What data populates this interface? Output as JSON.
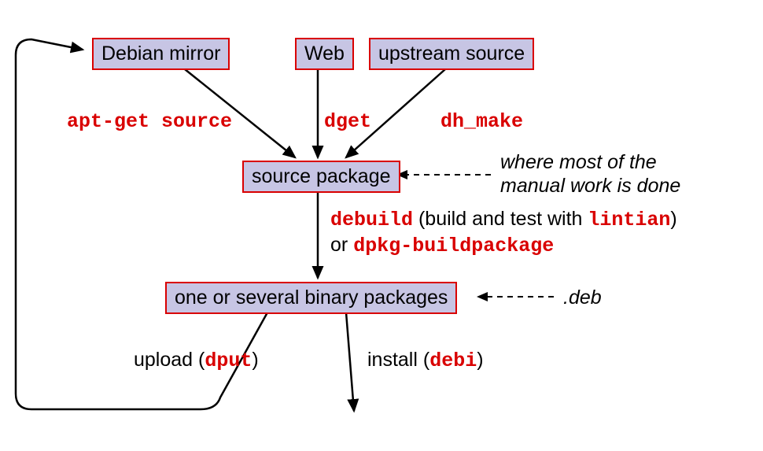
{
  "nodes": {
    "debian_mirror": "Debian mirror",
    "web": "Web",
    "upstream_source": "upstream source",
    "source_package": "source package",
    "binary_packages": "one or several binary packages"
  },
  "edges": {
    "apt_get_source": "apt-get source",
    "dget": "dget",
    "dh_make": "dh_make",
    "debuild_pre": "debuild",
    "debuild_mid": " (build and test with ",
    "lintian": "lintian",
    "debuild_post": ")",
    "or_text": "or ",
    "dpkg_buildpackage": "dpkg-buildpackage",
    "upload_pre": "upload (",
    "dput": "dput",
    "upload_post": ")",
    "install_pre": "install (",
    "debi": "debi",
    "install_post": ")"
  },
  "annotations": {
    "manual_work_line1": "where most of the",
    "manual_work_line2": "manual work is done",
    "deb_ext": ".deb"
  }
}
